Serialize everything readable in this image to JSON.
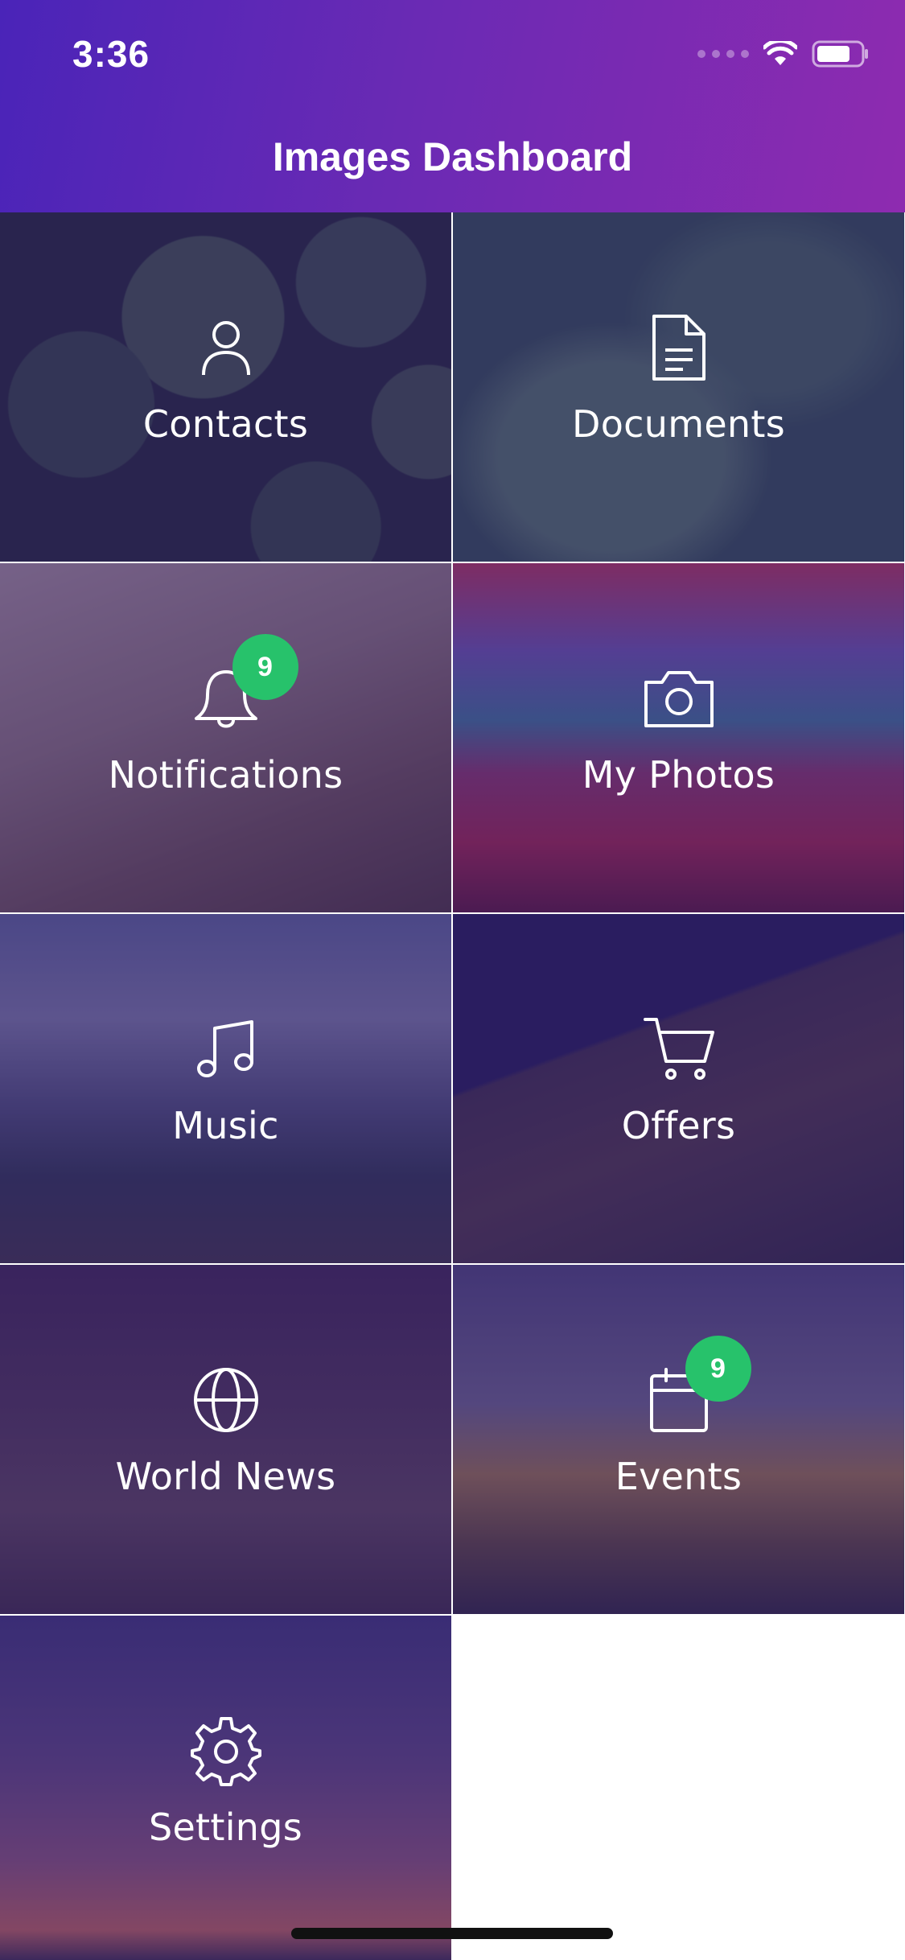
{
  "status_bar": {
    "time": "3:36"
  },
  "header": {
    "title": "Images Dashboard"
  },
  "tiles": [
    {
      "label": "Contacts",
      "icon": "person-icon"
    },
    {
      "label": "Documents",
      "icon": "document-icon"
    },
    {
      "label": "Notifications",
      "icon": "bell-icon",
      "badge": "9"
    },
    {
      "label": "My Photos",
      "icon": "camera-icon"
    },
    {
      "label": "Music",
      "icon": "music-note-icon"
    },
    {
      "label": "Offers",
      "icon": "shopping-cart-icon"
    },
    {
      "label": "World News",
      "icon": "globe-icon"
    },
    {
      "label": "Events",
      "icon": "calendar-icon",
      "badge": "9"
    },
    {
      "label": "Settings",
      "icon": "gear-icon"
    }
  ],
  "colors": {
    "header_gradient_start": "#4a24b8",
    "header_gradient_end": "#8e2bb0",
    "badge": "#27c26b",
    "tile_overlay": "#3a1c82"
  }
}
